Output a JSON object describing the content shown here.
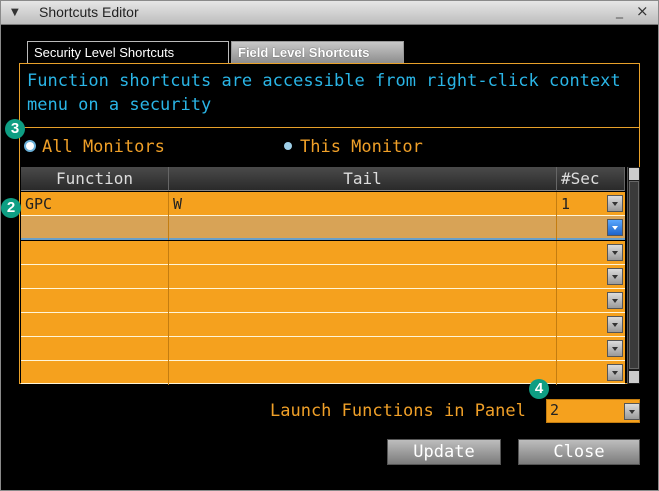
{
  "window": {
    "title": "Shortcuts Editor",
    "collapse_glyph": "▼",
    "minimize_glyph": "_",
    "close_glyph": "×"
  },
  "tabs": [
    {
      "label": "Security Level Shortcuts",
      "active": true
    },
    {
      "label": "Field Level Shortcuts",
      "active": false
    }
  ],
  "info_text": "Function shortcuts are accessible from right-click context menu on a security",
  "scope": {
    "options": [
      {
        "label": "All Monitors",
        "selected": true
      },
      {
        "label": "This Monitor",
        "selected": false
      }
    ]
  },
  "grid": {
    "columns": [
      "Function",
      "Tail",
      "#Sec"
    ],
    "rows": [
      {
        "function": "GPC",
        "tail": "W",
        "sec": "1"
      },
      {
        "function": "",
        "tail": "",
        "sec": ""
      },
      {
        "function": "",
        "tail": "",
        "sec": ""
      },
      {
        "function": "",
        "tail": "",
        "sec": ""
      },
      {
        "function": "",
        "tail": "",
        "sec": ""
      },
      {
        "function": "",
        "tail": "",
        "sec": ""
      },
      {
        "function": "",
        "tail": "",
        "sec": ""
      },
      {
        "function": "",
        "tail": "",
        "sec": ""
      }
    ]
  },
  "launch": {
    "label": "Launch Functions in Panel",
    "value": "2"
  },
  "buttons": {
    "update": "Update",
    "close": "Close"
  },
  "badges": {
    "b2": "2",
    "b3": "3",
    "b4": "4"
  },
  "colors": {
    "accent": "#f5a11e",
    "info": "#2ab5e6",
    "badge": "#0e9e83"
  }
}
